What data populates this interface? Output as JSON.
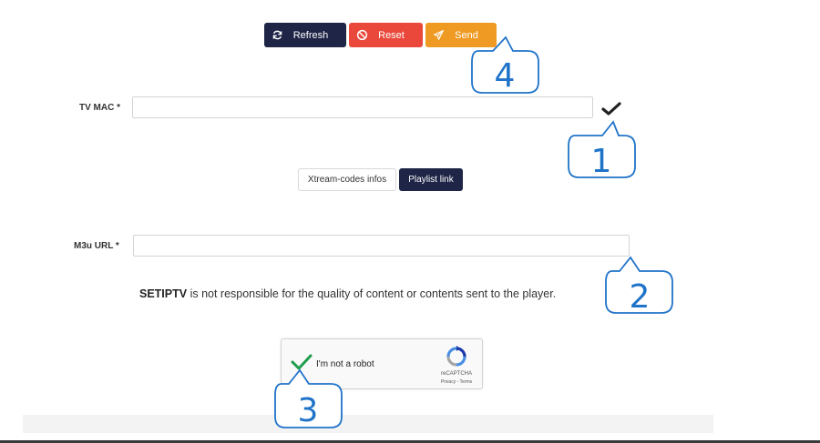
{
  "toolbar": {
    "refresh_label": "Refresh",
    "reset_label": "Reset",
    "send_label": "Send",
    "colors": {
      "refresh": "#1e2546",
      "reset": "#e9483b",
      "send": "#ef9a22"
    }
  },
  "form": {
    "tv_mac": {
      "label": "TV MAC *",
      "value": ""
    },
    "m3u_url": {
      "label": "M3u URL *",
      "value": ""
    }
  },
  "tabs": [
    {
      "label": "Xtream-codes infos",
      "active": false
    },
    {
      "label": "Playlist link",
      "active": true
    }
  ],
  "disclaimer": {
    "brand": "SETIPTV",
    "text": " is not responsible for the quality of content or contents sent to the player."
  },
  "captcha": {
    "label": "I'm not a robot",
    "brand": "reCAPTCHA",
    "links": "Privacy - Terms",
    "checked": true
  },
  "callouts": [
    "1",
    "2",
    "3",
    "4"
  ],
  "accent_color": "#1f73c9"
}
